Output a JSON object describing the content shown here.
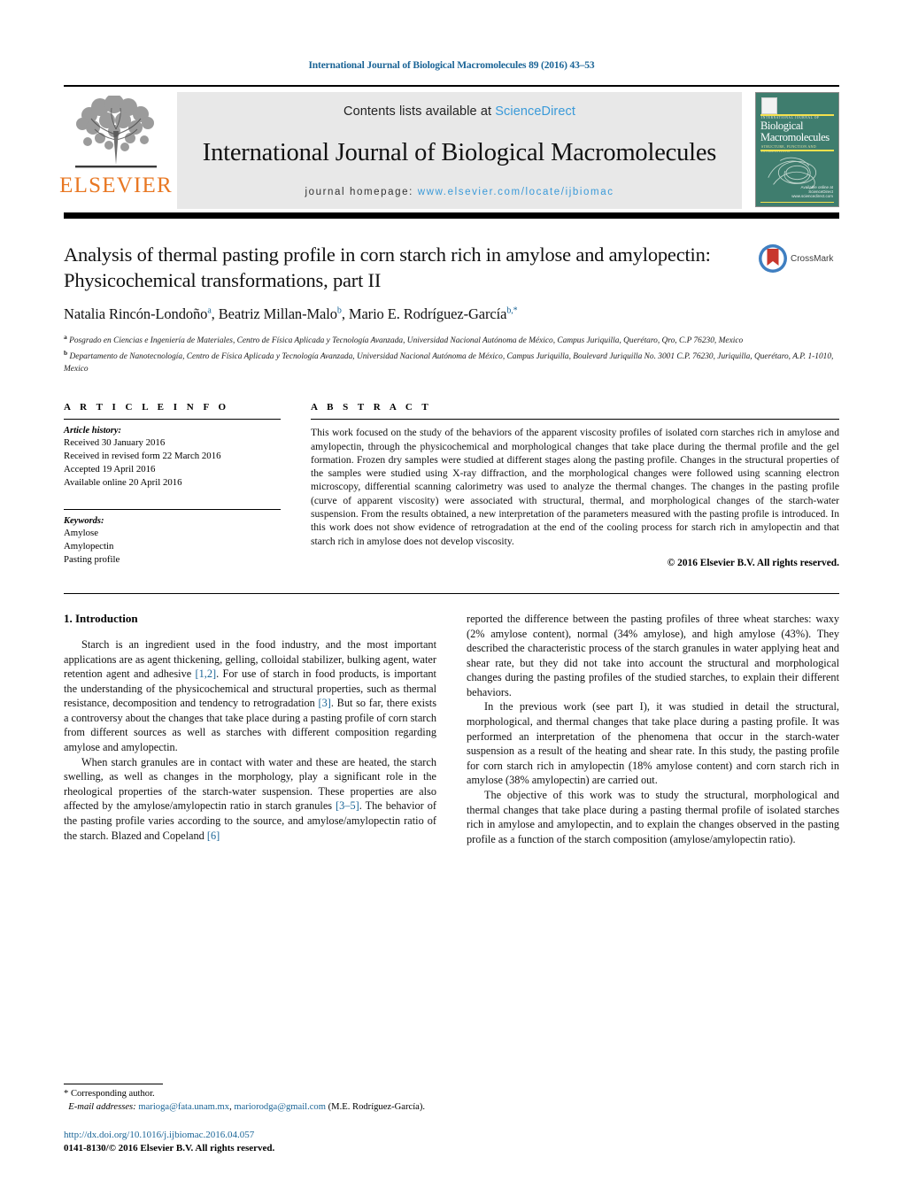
{
  "running_head": "International Journal of Biological Macromolecules 89 (2016) 43–53",
  "masthead": {
    "publisher_name": "ELSEVIER",
    "contents_prefix": "Contents lists available at ",
    "contents_link": "ScienceDirect",
    "journal_title": "International Journal of Biological Macromolecules",
    "homepage_prefix": "journal homepage: ",
    "homepage_url": "www.elsevier.com/locate/ijbiomac",
    "cover": {
      "eyebrow": "INTERNATIONAL JOURNAL OF",
      "title_line1": "Biological",
      "title_line2": "Macromolecules",
      "subtitle": "STRUCTURE, FUNCTION AND INTERACTIONS",
      "imprint": "Available online at",
      "imprint2": "ScienceDirect",
      "imprint3": "www.sciencedirect.com"
    }
  },
  "article": {
    "title": "Analysis of thermal pasting profile in corn starch rich in amylose and amylopectin: Physicochemical transformations, part II",
    "crossmark_label": "CrossMark",
    "authors": [
      {
        "name": "Natalia Rincón-Londoño",
        "marks": "a",
        "sep": ", "
      },
      {
        "name": "Beatriz Millan-Malo",
        "marks": "b",
        "sep": ", "
      },
      {
        "name": "Mario E. Rodríguez-García",
        "marks": "b,*",
        "sep": ""
      }
    ],
    "affiliations": [
      {
        "mark": "a",
        "text": "Posgrado en Ciencias e Ingeniería de Materiales, Centro de Física Aplicada y Tecnología Avanzada, Universidad Nacional Autónoma de México, Campus Juriquilla, Querétaro, Qro, C.P 76230, Mexico"
      },
      {
        "mark": "b",
        "text": "Departamento de Nanotecnología, Centro de Física Aplicada y Tecnología Avanzada, Universidad Nacional Autónoma de México, Campus Juriquilla, Boulevard Juriquilla No. 3001 C.P. 76230, Juriquilla, Querétaro, A.P. 1-1010, Mexico"
      }
    ]
  },
  "article_info": {
    "label": "A R T I C L E  I N F O",
    "history_title": "Article history:",
    "history": [
      "Received 30 January 2016",
      "Received in revised form 22 March 2016",
      "Accepted 19 April 2016",
      "Available online 20 April 2016"
    ],
    "keywords_title": "Keywords:",
    "keywords": [
      "Amylose",
      "Amylopectin",
      "Pasting profile"
    ]
  },
  "abstract": {
    "label": "A B S T R A C T",
    "text": "This work focused on the study of the behaviors of the apparent viscosity profiles of isolated corn starches rich in amylose and amylopectin, through the physicochemical and morphological changes that take place during the thermal profile and the gel formation. Frozen dry samples were studied at different stages along the pasting profile. Changes in the structural properties of the samples were studied using X-ray diffraction, and the morphological changes were followed using scanning electron microscopy, differential scanning calorimetry was used to analyze the thermal changes. The changes in the pasting profile (curve of apparent viscosity) were associated with structural, thermal, and morphological changes of the starch-water suspension. From the results obtained, a new interpretation of the parameters measured with the pasting profile is introduced. In this work does not show evidence of retrogradation at the end of the cooling process for starch rich in amylopectin and that starch rich in amylose does not develop viscosity.",
    "copyright": "© 2016 Elsevier B.V. All rights reserved."
  },
  "body": {
    "section_number_title": "1.  Introduction",
    "left_paragraphs": [
      "Starch is an ingredient used in the food industry, and the most important applications are as agent thickening, gelling, colloidal stabilizer, bulking agent, water retention agent and adhesive [1,2]. For use of starch in food products, is important the understanding of the physicochemical and structural properties, such as thermal resistance, decomposition and tendency to retrogradation [3]. But so far, there exists a controversy about the changes that take place during a pasting profile of corn starch from different sources as well as starches with different composition regarding amylose and amylopectin.",
      "When starch granules are in contact with water and these are heated, the starch swelling, as well as changes in the morphology, play a significant role in the rheological properties of the starch-water suspension. These properties are also affected by the amylose/amylopectin ratio in starch granules [3–5]. The behavior of the pasting profile varies according to the source, and amylose/amylopectin ratio of the starch. Blazed and Copeland [6]"
    ],
    "right_paragraphs": [
      "reported the difference between the pasting profiles of three wheat starches: waxy (2% amylose content), normal (34% amylose), and high amylose (43%). They described the characteristic process of the starch granules in water applying heat and shear rate, but they did not take into account the structural and morphological changes during the pasting profiles of the studied starches, to explain their different behaviors.",
      "In the previous work (see part I), it was studied in detail the structural, morphological, and thermal changes that take place during a pasting profile. It was performed an interpretation of the phenomena that occur in the starch-water suspension as a result of the heating and shear rate. In this study, the pasting profile for corn starch rich in amylopectin (18% amylose content) and corn starch rich in amylose (38% amylopectin) are carried out.",
      "The objective of this work was to study the structural, morphological and thermal changes that take place during a pasting thermal profile of isolated starches rich in amylose and amylopectin, and to explain the changes observed in the pasting profile as a function of the starch composition (amylose/amylopectin ratio)."
    ]
  },
  "footnote": {
    "corresponding": "*  Corresponding author.",
    "email_label": "E-mail addresses:",
    "email1": "marioga@fata.unam.mx",
    "email_sep": ", ",
    "email2": "mariorodga@gmail.com",
    "email_owner": "(M.E. Rodríguez-García).",
    "doi": "http://dx.doi.org/10.1016/j.ijbiomac.2016.04.057",
    "issn_line": "0141-8130/© 2016 Elsevier B.V. All rights reserved."
  },
  "colors": {
    "link": "#1a6496",
    "sciencedirect": "#3a9ad9",
    "elsevier_orange": "#E87722",
    "cover_green": "#3f7d6e",
    "crossmark_red": "#c8372d",
    "crossmark_blue": "#3f7fc1"
  }
}
